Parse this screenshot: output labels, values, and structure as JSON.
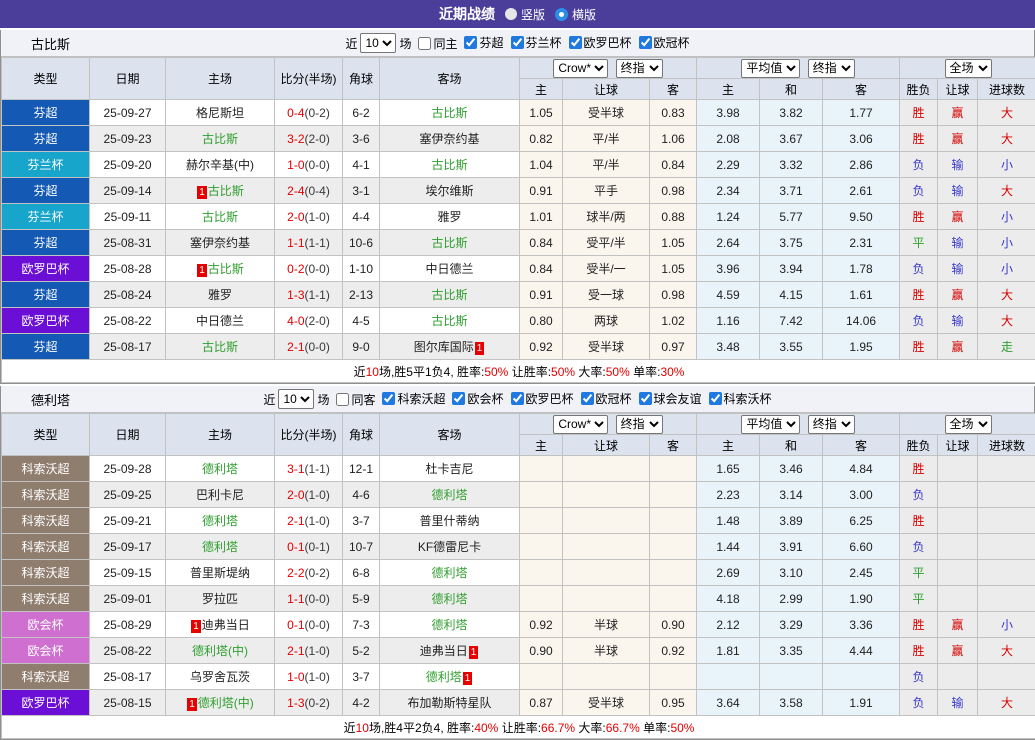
{
  "title_bar": {
    "title": "近期战绩",
    "vertical": "竖版",
    "horizontal": "横版"
  },
  "league_colors": {
    "芬超": "#1459b3",
    "芬兰杯": "#18a5cc",
    "欧罗巴杯": "#6b0fd6",
    "科索沃超": "#8f7d6e",
    "欧会杯": "#cf6fd0"
  },
  "table_header": {
    "type": "类型",
    "date": "日期",
    "home": "主场",
    "score": "比分(半场)",
    "corner": "角球",
    "away": "客场",
    "crow_select": "Crow*",
    "final_select": "终指",
    "avg_select": "平均值",
    "final_select2": "终指",
    "full_select": "全场",
    "sub_home": "主",
    "sub_handicap": "让球",
    "sub_away": "客",
    "sub_avg_home": "主",
    "sub_draw": "和",
    "sub_avg_away": "客",
    "sub_result": "胜负",
    "sub_handicap2": "让球",
    "sub_goals": "进球数"
  },
  "filter_common": {
    "near": "近",
    "games": "场",
    "count": "10"
  },
  "sections": [
    {
      "team": "古比斯",
      "same_label": "同主",
      "same_checked": false,
      "leagues": [
        {
          "label": "芬超",
          "checked": true
        },
        {
          "label": "芬兰杯",
          "checked": true
        },
        {
          "label": "欧罗巴杯",
          "checked": true
        },
        {
          "label": "欧冠杯",
          "checked": true
        }
      ],
      "rows": [
        {
          "lg": "芬超",
          "date": "25-09-27",
          "home": {
            "n": "格尼斯坦"
          },
          "ft": "0-4",
          "ht": "(0-2)",
          "cn": "6-2",
          "away": {
            "n": "古比斯",
            "g": 1
          },
          "crow": [
            "1.05",
            "受半球",
            "0.83"
          ],
          "avg": [
            "3.98",
            "3.82",
            "1.77"
          ],
          "res": [
            [
              "胜",
              "r"
            ],
            [
              "赢",
              "r"
            ],
            [
              "大",
              "r"
            ]
          ]
        },
        {
          "lg": "芬超",
          "date": "25-09-23",
          "home": {
            "n": "古比斯",
            "g": 1
          },
          "ft": "3-2",
          "ht": "(2-0)",
          "cn": "3-6",
          "away": {
            "n": "塞伊奈约基"
          },
          "crow": [
            "0.82",
            "平/半",
            "1.06"
          ],
          "avg": [
            "2.08",
            "3.67",
            "3.06"
          ],
          "res": [
            [
              "胜",
              "r"
            ],
            [
              "赢",
              "r"
            ],
            [
              "大",
              "r"
            ]
          ]
        },
        {
          "lg": "芬兰杯",
          "date": "25-09-20",
          "home": {
            "n": "赫尔辛基(中)"
          },
          "ft": "1-0",
          "ht": "(0-0)",
          "cn": "4-1",
          "away": {
            "n": "古比斯",
            "g": 1
          },
          "crow": [
            "1.04",
            "平/半",
            "0.84"
          ],
          "avg": [
            "2.29",
            "3.32",
            "2.86"
          ],
          "res": [
            [
              "负",
              "b"
            ],
            [
              "输",
              "b"
            ],
            [
              "小",
              "b"
            ]
          ]
        },
        {
          "lg": "芬超",
          "date": "25-09-14",
          "home": {
            "n": "古比斯",
            "g": 1,
            "rb": 1
          },
          "ft": "2-4",
          "ht": "(0-4)",
          "cn": "3-1",
          "away": {
            "n": "埃尔维斯"
          },
          "crow": [
            "0.91",
            "平手",
            "0.98"
          ],
          "avg": [
            "2.34",
            "3.71",
            "2.61"
          ],
          "res": [
            [
              "负",
              "b"
            ],
            [
              "输",
              "b"
            ],
            [
              "大",
              "r"
            ]
          ]
        },
        {
          "lg": "芬兰杯",
          "date": "25-09-11",
          "home": {
            "n": "古比斯",
            "g": 1
          },
          "ft": "2-0",
          "ht": "(1-0)",
          "cn": "4-4",
          "away": {
            "n": "雅罗"
          },
          "crow": [
            "1.01",
            "球半/两",
            "0.88"
          ],
          "avg": [
            "1.24",
            "5.77",
            "9.50"
          ],
          "res": [
            [
              "胜",
              "r"
            ],
            [
              "赢",
              "r"
            ],
            [
              "小",
              "b"
            ]
          ]
        },
        {
          "lg": "芬超",
          "date": "25-08-31",
          "home": {
            "n": "塞伊奈约基"
          },
          "ft": "1-1",
          "ht": "(1-1)",
          "cn": "10-6",
          "away": {
            "n": "古比斯",
            "g": 1
          },
          "crow": [
            "0.84",
            "受平/半",
            "1.05"
          ],
          "avg": [
            "2.64",
            "3.75",
            "2.31"
          ],
          "res": [
            [
              "平",
              "g"
            ],
            [
              "输",
              "b"
            ],
            [
              "小",
              "b"
            ]
          ]
        },
        {
          "lg": "欧罗巴杯",
          "date": "25-08-28",
          "home": {
            "n": "古比斯",
            "g": 1,
            "rb": 1
          },
          "ft": "0-2",
          "ht": "(0-0)",
          "cn": "1-10",
          "away": {
            "n": "中日德兰"
          },
          "crow": [
            "0.84",
            "受半/一",
            "1.05"
          ],
          "avg": [
            "3.96",
            "3.94",
            "1.78"
          ],
          "res": [
            [
              "负",
              "b"
            ],
            [
              "输",
              "b"
            ],
            [
              "小",
              "b"
            ]
          ]
        },
        {
          "lg": "芬超",
          "date": "25-08-24",
          "home": {
            "n": "雅罗"
          },
          "ft": "1-3",
          "ht": "(1-1)",
          "cn": "2-13",
          "away": {
            "n": "古比斯",
            "g": 1
          },
          "crow": [
            "0.91",
            "受一球",
            "0.98"
          ],
          "avg": [
            "4.59",
            "4.15",
            "1.61"
          ],
          "res": [
            [
              "胜",
              "r"
            ],
            [
              "赢",
              "r"
            ],
            [
              "大",
              "r"
            ]
          ]
        },
        {
          "lg": "欧罗巴杯",
          "date": "25-08-22",
          "home": {
            "n": "中日德兰"
          },
          "ft": "4-0",
          "ht": "(2-0)",
          "cn": "4-5",
          "away": {
            "n": "古比斯",
            "g": 1
          },
          "crow": [
            "0.80",
            "两球",
            "1.02"
          ],
          "avg": [
            "1.16",
            "7.42",
            "14.06"
          ],
          "res": [
            [
              "负",
              "b"
            ],
            [
              "输",
              "b"
            ],
            [
              "大",
              "r"
            ]
          ]
        },
        {
          "lg": "芬超",
          "date": "25-08-17",
          "home": {
            "n": "古比斯",
            "g": 1
          },
          "ft": "2-1",
          "ht": "(0-0)",
          "cn": "9-0",
          "away": {
            "n": "图尔库国际",
            "ra": 1
          },
          "crow": [
            "0.92",
            "受半球",
            "0.97"
          ],
          "avg": [
            "3.48",
            "3.55",
            "1.95"
          ],
          "res": [
            [
              "胜",
              "r"
            ],
            [
              "赢",
              "r"
            ],
            [
              "走",
              "g"
            ]
          ]
        }
      ],
      "summary": [
        [
          "近",
          0
        ],
        [
          "10",
          1
        ],
        [
          "场,胜5平1负4, 胜率:",
          0
        ],
        [
          "50%",
          1
        ],
        [
          " 让胜率:",
          0
        ],
        [
          "50%",
          1
        ],
        [
          " 大率:",
          0
        ],
        [
          "50%",
          1
        ],
        [
          " 单率:",
          0
        ],
        [
          "30%",
          1
        ]
      ]
    },
    {
      "team": "德利塔",
      "same_label": "同客",
      "same_checked": false,
      "leagues": [
        {
          "label": "科索沃超",
          "checked": true
        },
        {
          "label": "欧会杯",
          "checked": true
        },
        {
          "label": "欧罗巴杯",
          "checked": true
        },
        {
          "label": "欧冠杯",
          "checked": true
        },
        {
          "label": "球会友谊",
          "checked": true
        },
        {
          "label": "科索沃杯",
          "checked": true
        }
      ],
      "rows": [
        {
          "lg": "科索沃超",
          "date": "25-09-28",
          "home": {
            "n": "德利塔",
            "g": 1
          },
          "ft": "3-1",
          "ht": "(1-1)",
          "cn": "12-1",
          "away": {
            "n": "杜卡吉尼"
          },
          "crow": [
            "",
            "",
            ""
          ],
          "avg": [
            "1.65",
            "3.46",
            "4.84"
          ],
          "res": [
            [
              "胜",
              "r"
            ],
            [
              "",
              ""
            ],
            [
              "",
              ""
            ]
          ]
        },
        {
          "lg": "科索沃超",
          "date": "25-09-25",
          "home": {
            "n": "巴利卡尼"
          },
          "ft": "2-0",
          "ht": "(1-0)",
          "cn": "4-6",
          "away": {
            "n": "德利塔",
            "g": 1
          },
          "crow": [
            "",
            "",
            ""
          ],
          "avg": [
            "2.23",
            "3.14",
            "3.00"
          ],
          "res": [
            [
              "负",
              "b"
            ],
            [
              "",
              ""
            ],
            [
              "",
              ""
            ]
          ]
        },
        {
          "lg": "科索沃超",
          "date": "25-09-21",
          "home": {
            "n": "德利塔",
            "g": 1
          },
          "ft": "2-1",
          "ht": "(1-0)",
          "cn": "3-7",
          "away": {
            "n": "普里什蒂纳"
          },
          "crow": [
            "",
            "",
            ""
          ],
          "avg": [
            "1.48",
            "3.89",
            "6.25"
          ],
          "res": [
            [
              "胜",
              "r"
            ],
            [
              "",
              ""
            ],
            [
              "",
              ""
            ]
          ]
        },
        {
          "lg": "科索沃超",
          "date": "25-09-17",
          "home": {
            "n": "德利塔",
            "g": 1
          },
          "ft": "0-1",
          "ht": "(0-1)",
          "cn": "10-7",
          "away": {
            "n": "KF德雷尼卡"
          },
          "crow": [
            "",
            "",
            ""
          ],
          "avg": [
            "1.44",
            "3.91",
            "6.60"
          ],
          "res": [
            [
              "负",
              "b"
            ],
            [
              "",
              ""
            ],
            [
              "",
              ""
            ]
          ]
        },
        {
          "lg": "科索沃超",
          "date": "25-09-15",
          "home": {
            "n": "普里斯堤纳"
          },
          "ft": "2-2",
          "ht": "(0-2)",
          "cn": "6-8",
          "away": {
            "n": "德利塔",
            "g": 1
          },
          "crow": [
            "",
            "",
            ""
          ],
          "avg": [
            "2.69",
            "3.10",
            "2.45"
          ],
          "res": [
            [
              "平",
              "g"
            ],
            [
              "",
              ""
            ],
            [
              "",
              ""
            ]
          ]
        },
        {
          "lg": "科索沃超",
          "date": "25-09-01",
          "home": {
            "n": "罗拉匹"
          },
          "ft": "1-1",
          "ht": "(0-0)",
          "cn": "5-9",
          "away": {
            "n": "德利塔",
            "g": 1
          },
          "crow": [
            "",
            "",
            ""
          ],
          "avg": [
            "4.18",
            "2.99",
            "1.90"
          ],
          "res": [
            [
              "平",
              "g"
            ],
            [
              "",
              ""
            ],
            [
              "",
              ""
            ]
          ]
        },
        {
          "lg": "欧会杯",
          "date": "25-08-29",
          "home": {
            "n": "迪弗当日",
            "rb": 1
          },
          "ft": "0-1",
          "ht": "(0-0)",
          "cn": "7-3",
          "away": {
            "n": "德利塔",
            "g": 1
          },
          "crow": [
            "0.92",
            "半球",
            "0.90"
          ],
          "avg": [
            "2.12",
            "3.29",
            "3.36"
          ],
          "res": [
            [
              "胜",
              "r"
            ],
            [
              "赢",
              "r"
            ],
            [
              "小",
              "b"
            ]
          ]
        },
        {
          "lg": "欧会杯",
          "date": "25-08-22",
          "home": {
            "n": "德利塔(中)",
            "g": 1
          },
          "ft": "2-1",
          "ht": "(1-0)",
          "cn": "5-2",
          "away": {
            "n": "迪弗当日",
            "ra": 1
          },
          "crow": [
            "0.90",
            "半球",
            "0.92"
          ],
          "avg": [
            "1.81",
            "3.35",
            "4.44"
          ],
          "res": [
            [
              "胜",
              "r"
            ],
            [
              "赢",
              "r"
            ],
            [
              "大",
              "r"
            ]
          ]
        },
        {
          "lg": "科索沃超",
          "date": "25-08-17",
          "home": {
            "n": "乌罗舍瓦茨"
          },
          "ft": "1-0",
          "ht": "(1-0)",
          "cn": "3-7",
          "away": {
            "n": "德利塔",
            "g": 1,
            "ra": 1
          },
          "crow": [
            "",
            "",
            ""
          ],
          "avg": [
            "",
            "",
            ""
          ],
          "res": [
            [
              "负",
              "b"
            ],
            [
              "",
              ""
            ],
            [
              "",
              ""
            ]
          ]
        },
        {
          "lg": "欧罗巴杯",
          "date": "25-08-15",
          "home": {
            "n": "德利塔(中)",
            "g": 1,
            "rb": 1
          },
          "ft": "1-3",
          "ht": "(0-2)",
          "cn": "4-2",
          "away": {
            "n": "布加勒斯特星队"
          },
          "crow": [
            "0.87",
            "受半球",
            "0.95"
          ],
          "avg": [
            "3.64",
            "3.58",
            "1.91"
          ],
          "res": [
            [
              "负",
              "b"
            ],
            [
              "输",
              "b"
            ],
            [
              "大",
              "r"
            ]
          ]
        }
      ],
      "summary": [
        [
          "近",
          0
        ],
        [
          "10",
          1
        ],
        [
          "场,胜4平2负4, 胜率:",
          0
        ],
        [
          "40%",
          1
        ],
        [
          " 让胜率:",
          0
        ],
        [
          "66.7%",
          1
        ],
        [
          " 大率:",
          0
        ],
        [
          "66.7%",
          1
        ],
        [
          " 单率:",
          0
        ],
        [
          "50%",
          1
        ]
      ]
    }
  ]
}
